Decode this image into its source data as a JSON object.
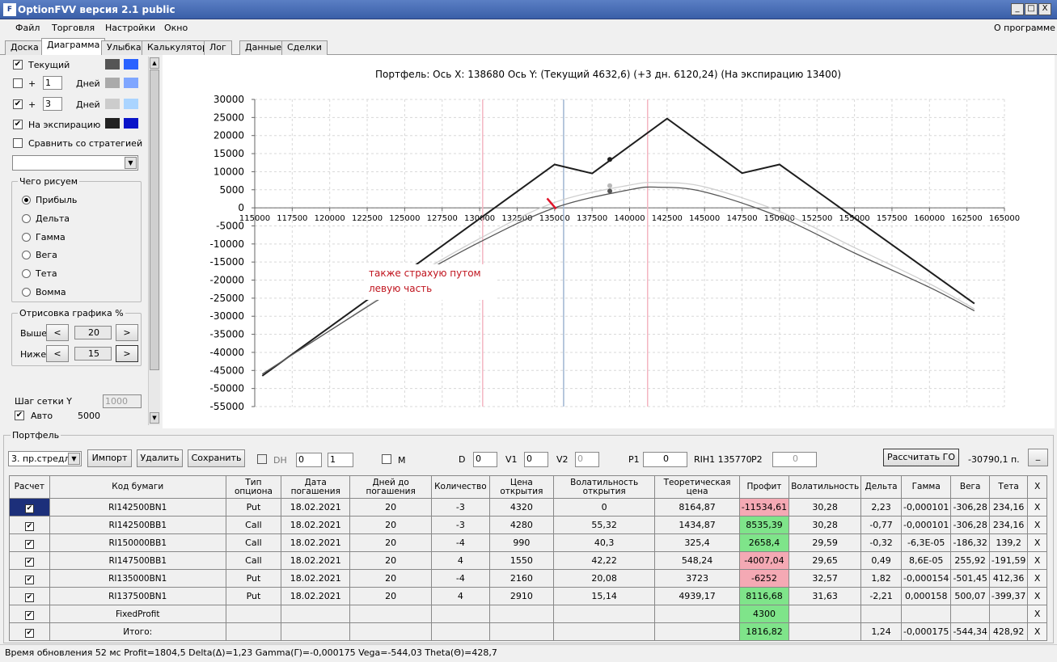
{
  "window": {
    "title": "OptionFVV версия 2.1 public",
    "min": "_",
    "max": "□",
    "close": "X"
  },
  "menu": {
    "items": [
      "Файл",
      "Торговля",
      "Настройки",
      "Окно"
    ],
    "about": "О программе"
  },
  "tabs": [
    "Доска",
    "Диаграмма",
    "Улыбка",
    "Калькулятор",
    "Лог",
    "Данные",
    "Сделки"
  ],
  "left": {
    "current": "Текущий",
    "plus": "+",
    "days": "Дней",
    "days1": "1",
    "days2": "3",
    "expiry": "На экспирацию",
    "compare": "Сравнить со стратегией",
    "draw_group": "Чего рисуем",
    "radios": [
      "Прибыль",
      "Дельта",
      "Гамма",
      "Вега",
      "Тета",
      "Вомма"
    ],
    "render_group": "Отрисовка графика %",
    "above": "Выше",
    "above_val": "20",
    "below": "Ниже",
    "below_val": "15",
    "lt": "<",
    "gt": ">",
    "grid_step": "Шаг сетки Y",
    "grid_step_val": "1000",
    "auto": "Авто",
    "auto_val": "5000"
  },
  "chart_data": {
    "type": "line",
    "title": "Портфель:  Ось X:  138680  Ось Y:   (Текущий 4632,6)  (+3 дн. 6120,24)  (На экспирацию 13400)",
    "annotation": [
      "также страхую путом",
      "левую часть"
    ],
    "xlim": [
      115000,
      165000
    ],
    "ylim": [
      -55000,
      30000
    ],
    "xticks": [
      115000,
      117500,
      120000,
      122500,
      125000,
      127500,
      130000,
      132500,
      135000,
      137500,
      140000,
      142500,
      145000,
      147500,
      150000,
      152500,
      155000,
      157500,
      160000,
      162500,
      165000
    ],
    "yticks": [
      30000,
      25000,
      20000,
      15000,
      10000,
      5000,
      0,
      -5000,
      -10000,
      -15000,
      -20000,
      -25000,
      -30000,
      -35000,
      -40000,
      -45000,
      -50000,
      -55000
    ],
    "vlines": [
      {
        "x": 130200,
        "color": "#f4b6c2"
      },
      {
        "x": 135600,
        "color": "#9fb6d2"
      },
      {
        "x": 141200,
        "color": "#f4b6c2"
      }
    ],
    "series": [
      {
        "name": "На экспирацию",
        "color": "#1e1e1e",
        "points": [
          [
            115500,
            -46500
          ],
          [
            135000,
            12000
          ],
          [
            137500,
            9500
          ],
          [
            142500,
            24700
          ],
          [
            147500,
            9600
          ],
          [
            150000,
            12000
          ],
          [
            163000,
            -26500
          ]
        ],
        "marker": [
          138680,
          13400
        ]
      },
      {
        "name": "+3 дн.",
        "color": "#cfcfcf",
        "curve": [
          [
            115500,
            -46000
          ],
          [
            120000,
            -34000
          ],
          [
            125000,
            -20500
          ],
          [
            130000,
            -8500
          ],
          [
            135000,
            1500
          ],
          [
            140000,
            6300
          ],
          [
            142000,
            7000
          ],
          [
            145000,
            5800
          ],
          [
            150000,
            -1000
          ],
          [
            155000,
            -11000
          ],
          [
            160000,
            -21000
          ],
          [
            163000,
            -28000
          ]
        ],
        "marker": [
          138680,
          6120
        ]
      },
      {
        "name": "Текущий",
        "color": "#555555",
        "curve": [
          [
            115500,
            -46000
          ],
          [
            120000,
            -34000
          ],
          [
            125000,
            -21000
          ],
          [
            130000,
            -9500
          ],
          [
            135000,
            0
          ],
          [
            140000,
            5000
          ],
          [
            142000,
            5700
          ],
          [
            145000,
            4400
          ],
          [
            150000,
            -2500
          ],
          [
            155000,
            -12500
          ],
          [
            160000,
            -22000
          ],
          [
            163000,
            -28500
          ]
        ],
        "marker": [
          138680,
          4632
        ]
      }
    ]
  },
  "portfolio": {
    "group": "Портфель",
    "strategy": "3. пр.стредл",
    "import": "Импорт",
    "delete": "Удалить",
    "save": "Сохранить",
    "dh": "DH",
    "spin1": "0",
    "spin2": "1",
    "m": "M",
    "d": "D",
    "d_val": "0",
    "v1": "V1",
    "v1_val": "0",
    "v2": "V2",
    "v2_val": "0",
    "p1": "P1",
    "p1_val": "0",
    "rih": "RIH1 135770",
    "p2": "P2",
    "p2_val": "0",
    "calc": "Рассчитать ГО",
    "go_val": "-30790,1 п.",
    "min_btn": "_"
  },
  "table": {
    "headers": [
      "Расчет",
      "Код бумаги",
      "Тип\nопциона",
      "Дата\nпогашения",
      "Дней до\nпогашения",
      "Количество",
      "Цена\nоткрытия",
      "Волатильность\nоткрытия",
      "Теоретическая\nцена",
      "Профит",
      "Волатильность",
      "Дельта",
      "Гамма",
      "Вега",
      "Тета",
      "X"
    ],
    "rows": [
      [
        "RI142500BN1",
        "Put",
        "18.02.2021",
        "20",
        "-3",
        "4320",
        "0",
        "8164,87",
        "-11534,61",
        "30,28",
        "2,23",
        "-0,000101",
        "-306,28",
        "234,16"
      ],
      [
        "RI142500BB1",
        "Call",
        "18.02.2021",
        "20",
        "-3",
        "4280",
        "55,32",
        "1434,87",
        "8535,39",
        "30,28",
        "-0,77",
        "-0,000101",
        "-306,28",
        "234,16"
      ],
      [
        "RI150000BB1",
        "Call",
        "18.02.2021",
        "20",
        "-4",
        "990",
        "40,3",
        "325,4",
        "2658,4",
        "29,59",
        "-0,32",
        "-6,3E-05",
        "-186,32",
        "139,2"
      ],
      [
        "RI147500BB1",
        "Call",
        "18.02.2021",
        "20",
        "4",
        "1550",
        "42,22",
        "548,24",
        "-4007,04",
        "29,65",
        "0,49",
        "8,6E-05",
        "255,92",
        "-191,59"
      ],
      [
        "RI135000BN1",
        "Put",
        "18.02.2021",
        "20",
        "-4",
        "2160",
        "20,08",
        "3723",
        "-6252",
        "32,57",
        "1,82",
        "-0,000154",
        "-501,45",
        "412,36"
      ],
      [
        "RI137500BN1",
        "Put",
        "18.02.2021",
        "20",
        "4",
        "2910",
        "15,14",
        "4939,17",
        "8116,68",
        "31,63",
        "-2,21",
        "0,000158",
        "500,07",
        "-399,37"
      ],
      [
        "FixedProfit",
        "",
        "",
        "",
        "",
        "",
        "",
        "",
        "4300",
        "",
        "",
        "",
        "",
        ""
      ],
      [
        "Итого:",
        "",
        "",
        "",
        "",
        "",
        "",
        "",
        "1816,82",
        "",
        "1,24",
        "-0,000175",
        "-544,34",
        "428,92"
      ]
    ],
    "check": "✔",
    "x": "X"
  },
  "status": "Время обновления 52 мс   Profit=1804,5 Delta(Δ)=1,23 Gamma(Γ)=-0,000175 Vega=-544,03 Theta(Θ)=428,7",
  "colors": {
    "red_cell": "#f4a9b4",
    "green_cell": "#7fe48a",
    "annot": "#c0141e"
  }
}
